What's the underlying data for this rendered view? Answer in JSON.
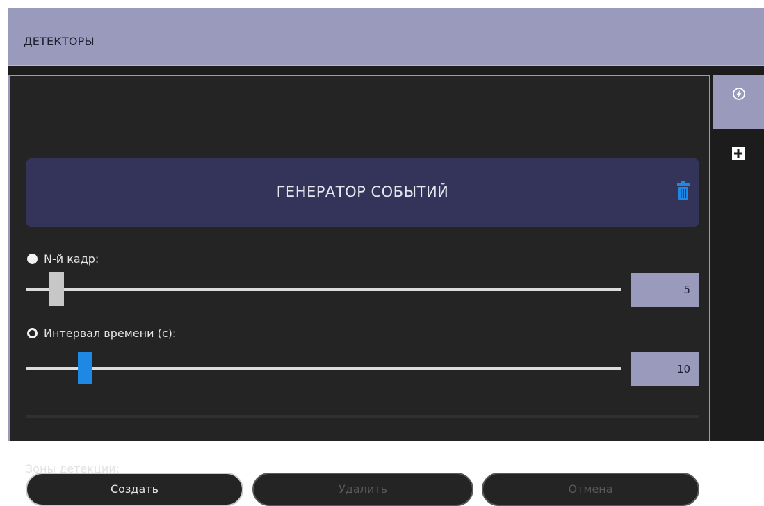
{
  "window": {
    "title": "ДЕТЕКТОРЫ"
  },
  "sidebar": {
    "items": [
      {
        "icon": "lightning-icon",
        "active": true
      },
      {
        "icon": "plus-icon",
        "active": false
      }
    ]
  },
  "detector": {
    "title": "ГЕНЕРАТОР СОБЫТИЙ",
    "delete_icon": "trash-icon",
    "accent_color": "#1e88e5",
    "nth_frame": {
      "label": "N-й кадр:",
      "value": "5",
      "selected": true
    },
    "time_interval": {
      "label": "Интервал времени (с):",
      "value": "10",
      "selected": false
    },
    "zones": {
      "label": "Зоны детекции:",
      "create_label": "Создать",
      "delete_label": "Удалить",
      "cancel_label": "Отмена"
    }
  }
}
